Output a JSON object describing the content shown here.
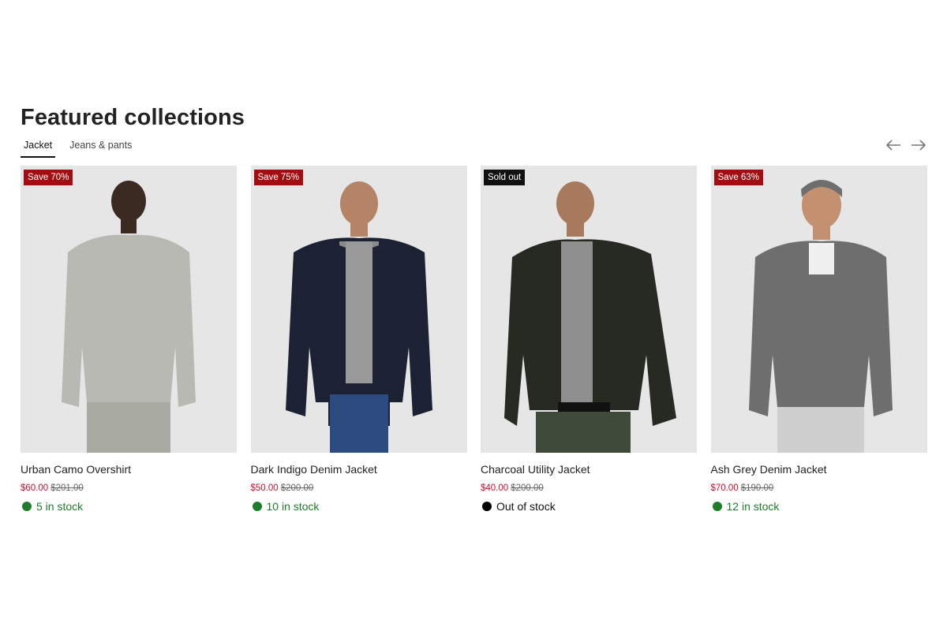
{
  "section": {
    "title": "Featured collections",
    "tabs": [
      {
        "label": "Jacket",
        "active": true
      },
      {
        "label": "Jeans & pants",
        "active": false
      }
    ],
    "prev_icon": "arrow-left-icon",
    "next_icon": "arrow-right-icon"
  },
  "products": [
    {
      "badge": "Save 70%",
      "badge_type": "sale",
      "name": "Urban Camo Overshirt",
      "price": "$60.00",
      "compare_price": "$201.00",
      "stock": "5 in stock",
      "stock_status": "in",
      "jacket_color": "#b8b9b2"
    },
    {
      "badge": "Save 75%",
      "badge_type": "sale",
      "name": "Dark Indigo Denim Jacket",
      "price": "$50.00",
      "compare_price": "$200.00",
      "stock": "10 in stock",
      "stock_status": "in",
      "jacket_color": "#1c2233"
    },
    {
      "badge": "Sold out",
      "badge_type": "soldout",
      "name": "Charcoal Utility Jacket",
      "price": "$40.00",
      "compare_price": "$200.00",
      "stock": "Out of stock",
      "stock_status": "out",
      "jacket_color": "#262a22"
    },
    {
      "badge": "Save 63%",
      "badge_type": "sale",
      "name": "Ash Grey Denim Jacket",
      "price": "$70.00",
      "compare_price": "$190.00",
      "stock": "12 in stock",
      "stock_status": "in",
      "jacket_color": "#6e6e6e"
    }
  ],
  "colors": {
    "sale_badge": "#a30d12",
    "sold_out_badge": "#111111",
    "sale_price": "#c8102e",
    "in_stock": "#1e7c2a",
    "image_bg": "#e6e6e6"
  }
}
